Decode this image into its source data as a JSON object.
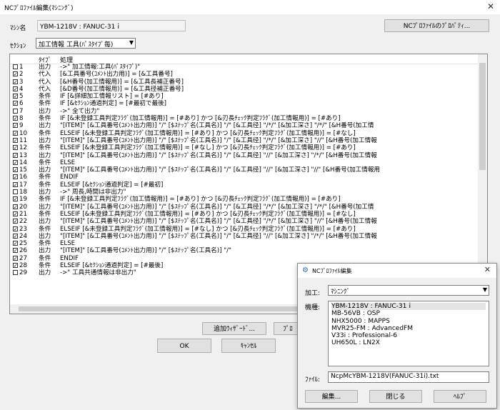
{
  "window": {
    "title": "NCﾌﾟﾛﾌｧｲﾙ編集(ﾏｼﾆﾝｸﾞ)",
    "close": "✕"
  },
  "machine": {
    "label": "ﾏｼﾝ名",
    "value": "YBM-1218V : FANUC-31ｉ"
  },
  "profile_button": "NCﾌﾟﾛﾌｧｲﾙのﾌﾟﾛﾊﾟﾃｨ...",
  "section": {
    "label": "ｾｸｼｮﾝ",
    "value": "加工情報 工具(ﾊﾟｽﾀｲﾌﾟ毎)"
  },
  "list": {
    "header": {
      "type": "ﾀｲﾌﾟ",
      "proc": "処理"
    },
    "rows": [
      {
        "check": "",
        "num": "1",
        "type": "出力",
        "proc": "->\" 加工情報:工具(ﾊﾟｽﾀｲﾌﾟ)\""
      },
      {
        "check": "✓",
        "num": "2",
        "type": "代入",
        "proc": "[&工具番号(ｺﾒﾝﾄ出力用)] = [&工具番号]"
      },
      {
        "check": "✓",
        "num": "3",
        "type": "代入",
        "proc": "[&H番号(加工情報用)] = [&工具長補正番号]"
      },
      {
        "check": "✓",
        "num": "4",
        "type": "代入",
        "proc": "[&D番号(加工情報用)] = [&工具径補正番号]"
      },
      {
        "check": "✓",
        "num": "5",
        "type": "条件",
        "proc": "IF [&詳細加工情報リスト] = [#あり]"
      },
      {
        "check": "✓",
        "num": "6",
        "type": "条件",
        "proc": "    IF [&ｾｸｼｮﾝ通過判定] = [#最初で最後]"
      },
      {
        "check": "",
        "num": "7",
        "type": "出力",
        "proc": "        ->\" 全て出力\""
      },
      {
        "check": "✓",
        "num": "8",
        "type": "条件",
        "proc": "        IF [&未登録工具判定ﾌﾗｸﾞ(加工情報用)] = [#あり] かつ [&刃長ﾁｪｯｸ判定ﾌﾗｸﾞ(加工情報用)] = [#あり]"
      },
      {
        "check": "✓",
        "num": "9",
        "type": "出力",
        "proc": "            \"[ITEM]\" [&工具番号(ｺﾒﾝﾄ出力用)] \"/\" [$ｽﾃｯﾌﾟ名(工具名)] \"/\" [&工具径] \"/*/\" [&加工深さ] \"/*/\" [&H番号(加工情"
      },
      {
        "check": "✓",
        "num": "10",
        "type": "条件",
        "proc": "        ELSEIF [&未登録工具判定ﾌﾗｸﾞ(加工情報用)] = [#あり] かつ [&刃長ﾁｪｯｸ判定ﾌﾗｸﾞ(加工情報用)] = [#なし]"
      },
      {
        "check": "✓",
        "num": "11",
        "type": "出力",
        "proc": "            \"[ITEM]\" [&工具番号(ｺﾒﾝﾄ出力用)] \"/\" [$ｽﾃｯﾌﾟ名(工具名)] \"/\" [&工具径] \"/*/\" [&加工深さ] \"//\" [&H番号(加工情報"
      },
      {
        "check": "✓",
        "num": "12",
        "type": "条件",
        "proc": "        ELSEIF [&未登録工具判定ﾌﾗｸﾞ(加工情報用)] = [#なし] かつ [&刃長ﾁｪｯｸ判定ﾌﾗｸﾞ(加工情報用)] = [#あり]"
      },
      {
        "check": "✓",
        "num": "13",
        "type": "出力",
        "proc": "            \"[ITEM]\" [&工具番号(ｺﾒﾝﾄ出力用)] \"/\" [$ｽﾃｯﾌﾟ名(工具名)] \"/\" [&工具径] \"//\" [&加工深さ] \"/*/\" [&H番号(加工情報"
      },
      {
        "check": "✓",
        "num": "14",
        "type": "条件",
        "proc": "        ELSE"
      },
      {
        "check": "✓",
        "num": "15",
        "type": "出力",
        "proc": "            \"[ITEM]\" [&工具番号(ｺﾒﾝﾄ出力用)] \"/\" [$ｽﾃｯﾌﾟ名(工具名)] \"/\" [&工具径] \"//\" [&加工深さ] \"//\" [&H番号(加工情報用"
      },
      {
        "check": "✓",
        "num": "16",
        "type": "条件",
        "proc": "        ENDIF"
      },
      {
        "check": "✓",
        "num": "17",
        "type": "条件",
        "proc": "    ELSEIF [&ｾｸｼｮﾝ通過判定] = [#最初]"
      },
      {
        "check": "",
        "num": "18",
        "type": "出力",
        "proc": "        ->\" 周長,時間は非出力\""
      },
      {
        "check": "✓",
        "num": "19",
        "type": "条件",
        "proc": "        IF [&未登録工具判定ﾌﾗｸﾞ(加工情報用)] = [#あり] かつ [&刃長ﾁｪｯｸ判定ﾌﾗｸﾞ(加工情報用)] = [#あり]"
      },
      {
        "check": "✓",
        "num": "20",
        "type": "出力",
        "proc": "            \"[ITEM]\" [&工具番号(ｺﾒﾝﾄ出力用)] \"/\" [$ｽﾃｯﾌﾟ名(工具名)] \"/\" [&工具径] \"/*/\" [&加工深さ] \"/*/\" [&H番号(加工情"
      },
      {
        "check": "✓",
        "num": "21",
        "type": "条件",
        "proc": "        ELSEIF [&未登録工具判定ﾌﾗｸﾞ(加工情報用)] = [#あり] かつ [&刃長ﾁｪｯｸ判定ﾌﾗｸﾞ(加工情報用)] = [#なし]"
      },
      {
        "check": "✓",
        "num": "22",
        "type": "出力",
        "proc": "            \"[ITEM]\" [&工具番号(ｺﾒﾝﾄ出力用)] \"/\" [$ｽﾃｯﾌﾟ名(工具名)] \"/\" [&工具径] \"/*/\" [&加工深さ] \"//\" [&H番号(加工情報"
      },
      {
        "check": "✓",
        "num": "23",
        "type": "条件",
        "proc": "        ELSEIF [&未登録工具判定ﾌﾗｸﾞ(加工情報用)] = [#なし] かつ [&刃長ﾁｪｯｸ判定ﾌﾗｸﾞ(加工情報用)] = [#あり]"
      },
      {
        "check": "✓",
        "num": "24",
        "type": "出力",
        "proc": "            \"[ITEM]\" [&工具番号(ｺﾒﾝﾄ出力用)] \"/\" [$ｽﾃｯﾌﾟ名(工具名)] \"/\" [&工具径] \"//\" [&加工深さ] \"/*/\" [&H番号(加工情報"
      },
      {
        "check": "✓",
        "num": "25",
        "type": "条件",
        "proc": "        ELSE"
      },
      {
        "check": "✓",
        "num": "26",
        "type": "出力",
        "proc": "            \"[ITEM]\" [&工具番号(ｺﾒﾝﾄ出力用)] \"/\" [$ｽﾃｯﾌﾟ名(工具名)] \"/\""
      },
      {
        "check": "✓",
        "num": "27",
        "type": "条件",
        "proc": "        ENDIF"
      },
      {
        "check": "✓",
        "num": "28",
        "type": "条件",
        "proc": "    ELSEIF [&ｾｸｼｮﾝ通過判定] = [#最後]"
      },
      {
        "check": "",
        "num": "29",
        "type": "出力",
        "proc": "        ->\" 工具共通情報は非出力\""
      }
    ]
  },
  "buttons": {
    "add_wizard": "追加ｳｨｻﾞｰﾄﾞ...",
    "property_partial": "ﾌﾟﾛ",
    "ok": "OK",
    "cancel": "ｷｬﾝｾﾙ"
  },
  "dialog": {
    "title": "NCﾌﾟﾛﾌｧｲﾙ編集",
    "close": "✕",
    "machining_label": "加工:",
    "machining_value": "ﾏｼﾆﾝｸﾞ",
    "model_label": "機種:",
    "models": [
      "YBM-1218V : FANUC-31ｉ",
      "MB-56VB : OSP",
      "NHX5000 : MAPPS",
      "MVR25-FM : AdvancedFM",
      "V33i : Professional-6",
      "UH650L : LN2X"
    ],
    "file_label": "ﾌｧｲﾙ:",
    "file_value": "NcpMcYBM-1218V(FANUC-31i).txt",
    "edit_button": "編集...",
    "close_button": "閉じる",
    "help_button": "ﾍﾙﾌﾟ"
  }
}
